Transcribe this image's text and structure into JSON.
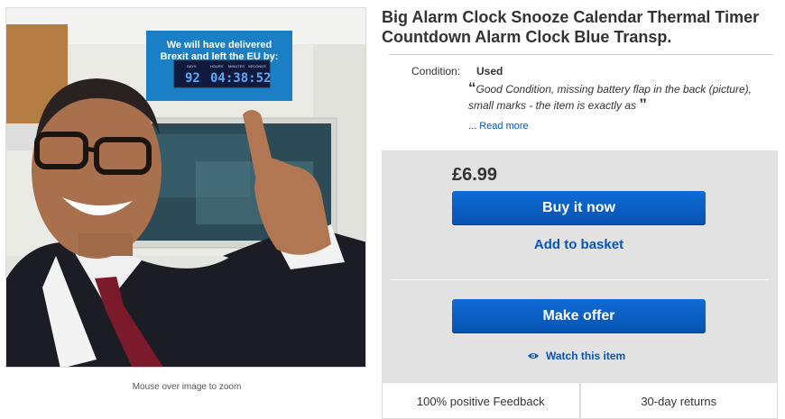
{
  "image": {
    "sign_line1": "We will have delivered",
    "sign_line2": "Brexit and left the EU by:",
    "clock_labels": [
      "DAYS",
      "HOURS",
      "MINUTES",
      "SECONDS"
    ],
    "clock_days": "92",
    "clock_time": "04:38:52",
    "zoom_hint": "Mouse over image to zoom"
  },
  "listing": {
    "title": "Big Alarm Clock Snooze Calendar Thermal Timer Countdown Alarm Clock Blue Transp.",
    "condition_label": "Condition:",
    "condition_value": "Used",
    "condition_note": "Good Condition, missing battery flap in the back (picture), small marks - the item is exactly as",
    "ellipsis": "...",
    "read_more": "Read more"
  },
  "buy_box": {
    "price": "£6.99",
    "buy_now": "Buy it now",
    "add_to_basket": "Add to basket",
    "make_offer": "Make offer",
    "watch": "Watch this item",
    "feedback": "100% positive Feedback",
    "returns": "30-day returns"
  },
  "colors": {
    "primary_button": "#0654ba",
    "link": "#0654ba",
    "buy_box_bg": "#e2e2e2"
  }
}
